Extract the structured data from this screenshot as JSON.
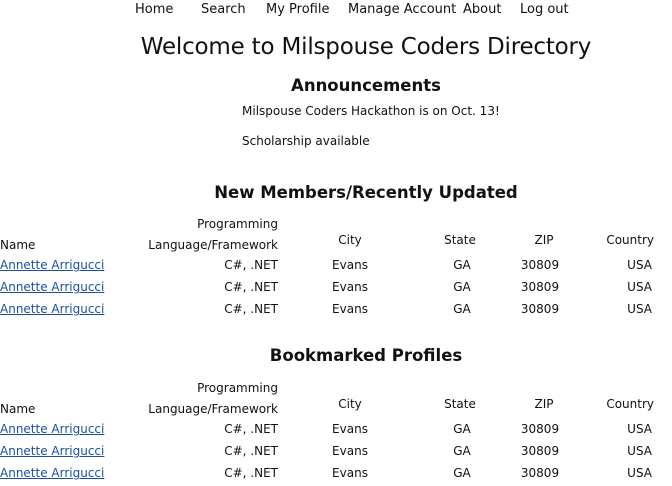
{
  "nav": {
    "home": "Home",
    "search": "Search",
    "profile": "My Profile",
    "account": "Manage Account",
    "about": "About",
    "logout": "Log out"
  },
  "page_title": "Welcome to Milspouse Coders Directory",
  "announcements": {
    "heading": "Announcements",
    "items": [
      "Milspouse Coders Hackathon is on Oct. 13!",
      "Scholarship available"
    ]
  },
  "table_headers": {
    "name": "Name",
    "lang_1": "Programming",
    "lang_2": "Language/Framework",
    "city": "City",
    "state": "State",
    "zip": "ZIP",
    "country": "Country"
  },
  "new_members": {
    "heading": "New Members/Recently Updated",
    "rows": [
      {
        "name": "Annette Arrigucci",
        "lang": "C#, .NET",
        "city": "Evans",
        "state": "GA",
        "zip": "30809",
        "country": "USA"
      },
      {
        "name": "Annette Arrigucci",
        "lang": "C#, .NET",
        "city": "Evans",
        "state": "GA",
        "zip": "30809",
        "country": "USA"
      },
      {
        "name": "Annette Arrigucci",
        "lang": "C#, .NET",
        "city": "Evans",
        "state": "GA",
        "zip": "30809",
        "country": "USA"
      }
    ]
  },
  "bookmarked": {
    "heading": "Bookmarked Profiles",
    "rows": [
      {
        "name": "Annette Arrigucci",
        "lang": "C#, .NET",
        "city": "Evans",
        "state": "GA",
        "zip": "30809",
        "country": "USA"
      },
      {
        "name": "Annette Arrigucci",
        "lang": "C#, .NET",
        "city": "Evans",
        "state": "GA",
        "zip": "30809",
        "country": "USA"
      },
      {
        "name": "Annette Arrigucci",
        "lang": "C#, .NET",
        "city": "Evans",
        "state": "GA",
        "zip": "30809",
        "country": "USA"
      }
    ]
  }
}
